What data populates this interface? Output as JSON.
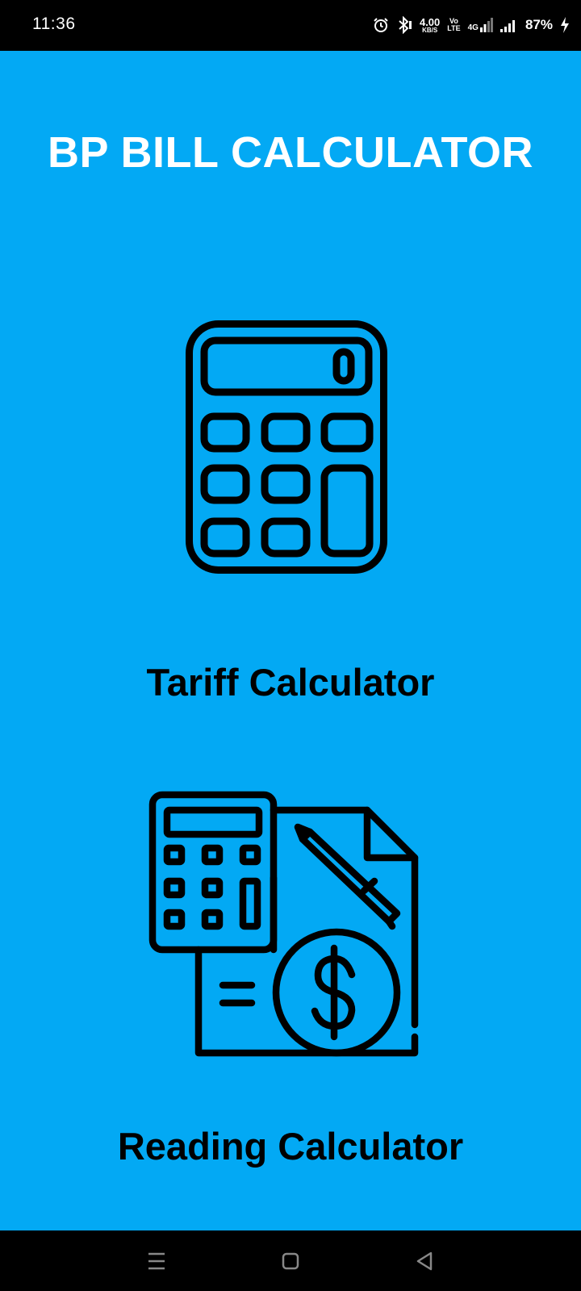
{
  "status_bar": {
    "time": "11:36",
    "net_speed_value": "4.00",
    "net_speed_unit": "KB/S",
    "volte_top": "Vo",
    "volte_bottom": "LTE",
    "network_type": "4G",
    "battery_percent": "87%",
    "icons": [
      "alarm-icon",
      "bluetooth-icon",
      "signal-icon",
      "battery-charging-icon"
    ]
  },
  "app": {
    "title": "BP BILL CALCULATOR",
    "background_color": "#03A9F4",
    "title_color": "#FFFFFF",
    "menu": [
      {
        "id": "tariff",
        "label": "Tariff Calculator",
        "icon": "calculator-icon"
      },
      {
        "id": "reading",
        "label": "Reading Calculator",
        "icon": "bill-reading-icon"
      }
    ]
  },
  "nav_bar": {
    "buttons": [
      "menu-icon",
      "home-icon",
      "back-icon"
    ]
  }
}
